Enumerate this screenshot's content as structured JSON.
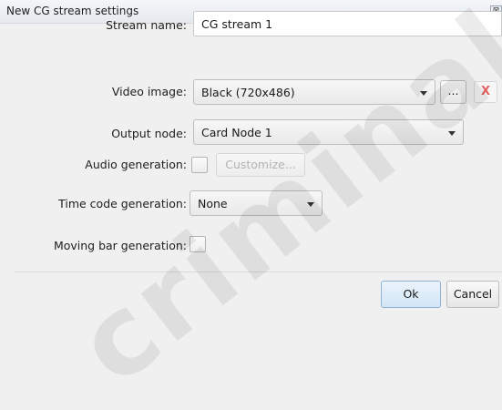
{
  "window": {
    "title": "New CG stream settings",
    "close_glyph": "⊠"
  },
  "form": {
    "stream_name": {
      "label": "Stream name:",
      "value": "CG stream 1"
    },
    "video_image": {
      "label": "Video image:",
      "value": "Black (720x486)",
      "browse_label": "...",
      "clear_label": "X"
    },
    "output_node": {
      "label": "Output node:",
      "value": "Card Node 1"
    },
    "audio_generation": {
      "label": "Audio generation:",
      "checked": false,
      "customize_label": "Customize..."
    },
    "time_code_generation": {
      "label": "Time code generation:",
      "value": "None"
    },
    "moving_bar_generation": {
      "label": "Moving bar generation:",
      "checked": false
    }
  },
  "buttons": {
    "ok": "Ok",
    "cancel": "Cancel"
  },
  "watermark": {
    "text": "criminal"
  },
  "colors": {
    "clear_button_text": "#e26060",
    "ok_button_bg": "#d3e6f7"
  }
}
